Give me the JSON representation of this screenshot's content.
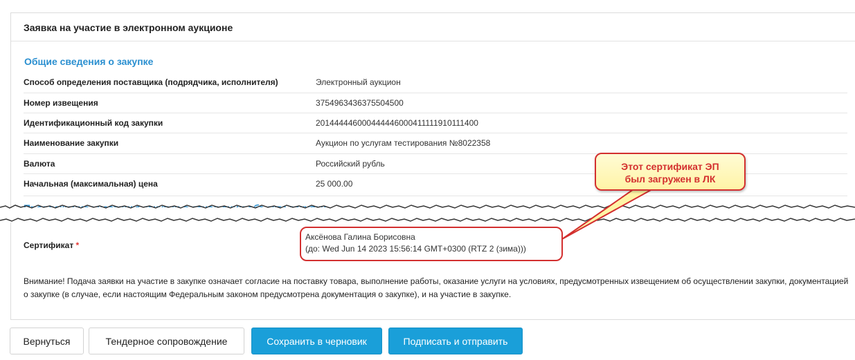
{
  "card": {
    "title": "Заявка на участие в электронном аукционе"
  },
  "general": {
    "title": "Общие сведения о закупке",
    "rows": [
      {
        "label": "Способ определения поставщика (подрядчика, исполнителя)",
        "value": "Электронный аукцион"
      },
      {
        "label": "Номер извещения",
        "value": "3754963436375504500"
      },
      {
        "label": "Идентификационный код закупки",
        "value": "201444446000444446000411111910111400"
      },
      {
        "label": "Наименование закупки",
        "value": "Аукцион по услугам тестирования №8022358"
      },
      {
        "label": "Валюта",
        "value": "Российский рубль"
      },
      {
        "label": "Начальная (максимальная) цена",
        "value": "25 000.00"
      }
    ]
  },
  "offer": {
    "title": "Предложение участника закупки в отношении объекта закупки"
  },
  "certificate": {
    "label": "Сертификат",
    "required_mark": "*",
    "owner": "Аксёнова Галина Борисовна",
    "valid_until": "(до: Wed Jun 14 2023 15:56:14 GMT+0300 (RTZ 2 (зима)))"
  },
  "warning_text": "Внимание! Подача заявки на участие в закупке означает согласие на поставку товара, выполнение работы, оказание услуги на условиях, предусмотренных извещением об осуществлении закупки, документацией о закупке (в случае, если настоящим Федеральным законом предусмотрена документация о закупке), и на участие в закупке.",
  "buttons": {
    "back": "Вернуться",
    "tender_support": "Тендерное сопровождение",
    "save_draft": "Сохранить в черновик",
    "sign_send": "Подписать и отправить"
  },
  "callout": {
    "line1": "Этот сертификат ЭП",
    "line2": "был загружен в ЛК"
  },
  "colors": {
    "accent": "#2a8fd0",
    "primary_button": "#1a9fd9",
    "highlight": "#d32f2f",
    "callout_bg": "#fff7b8"
  }
}
